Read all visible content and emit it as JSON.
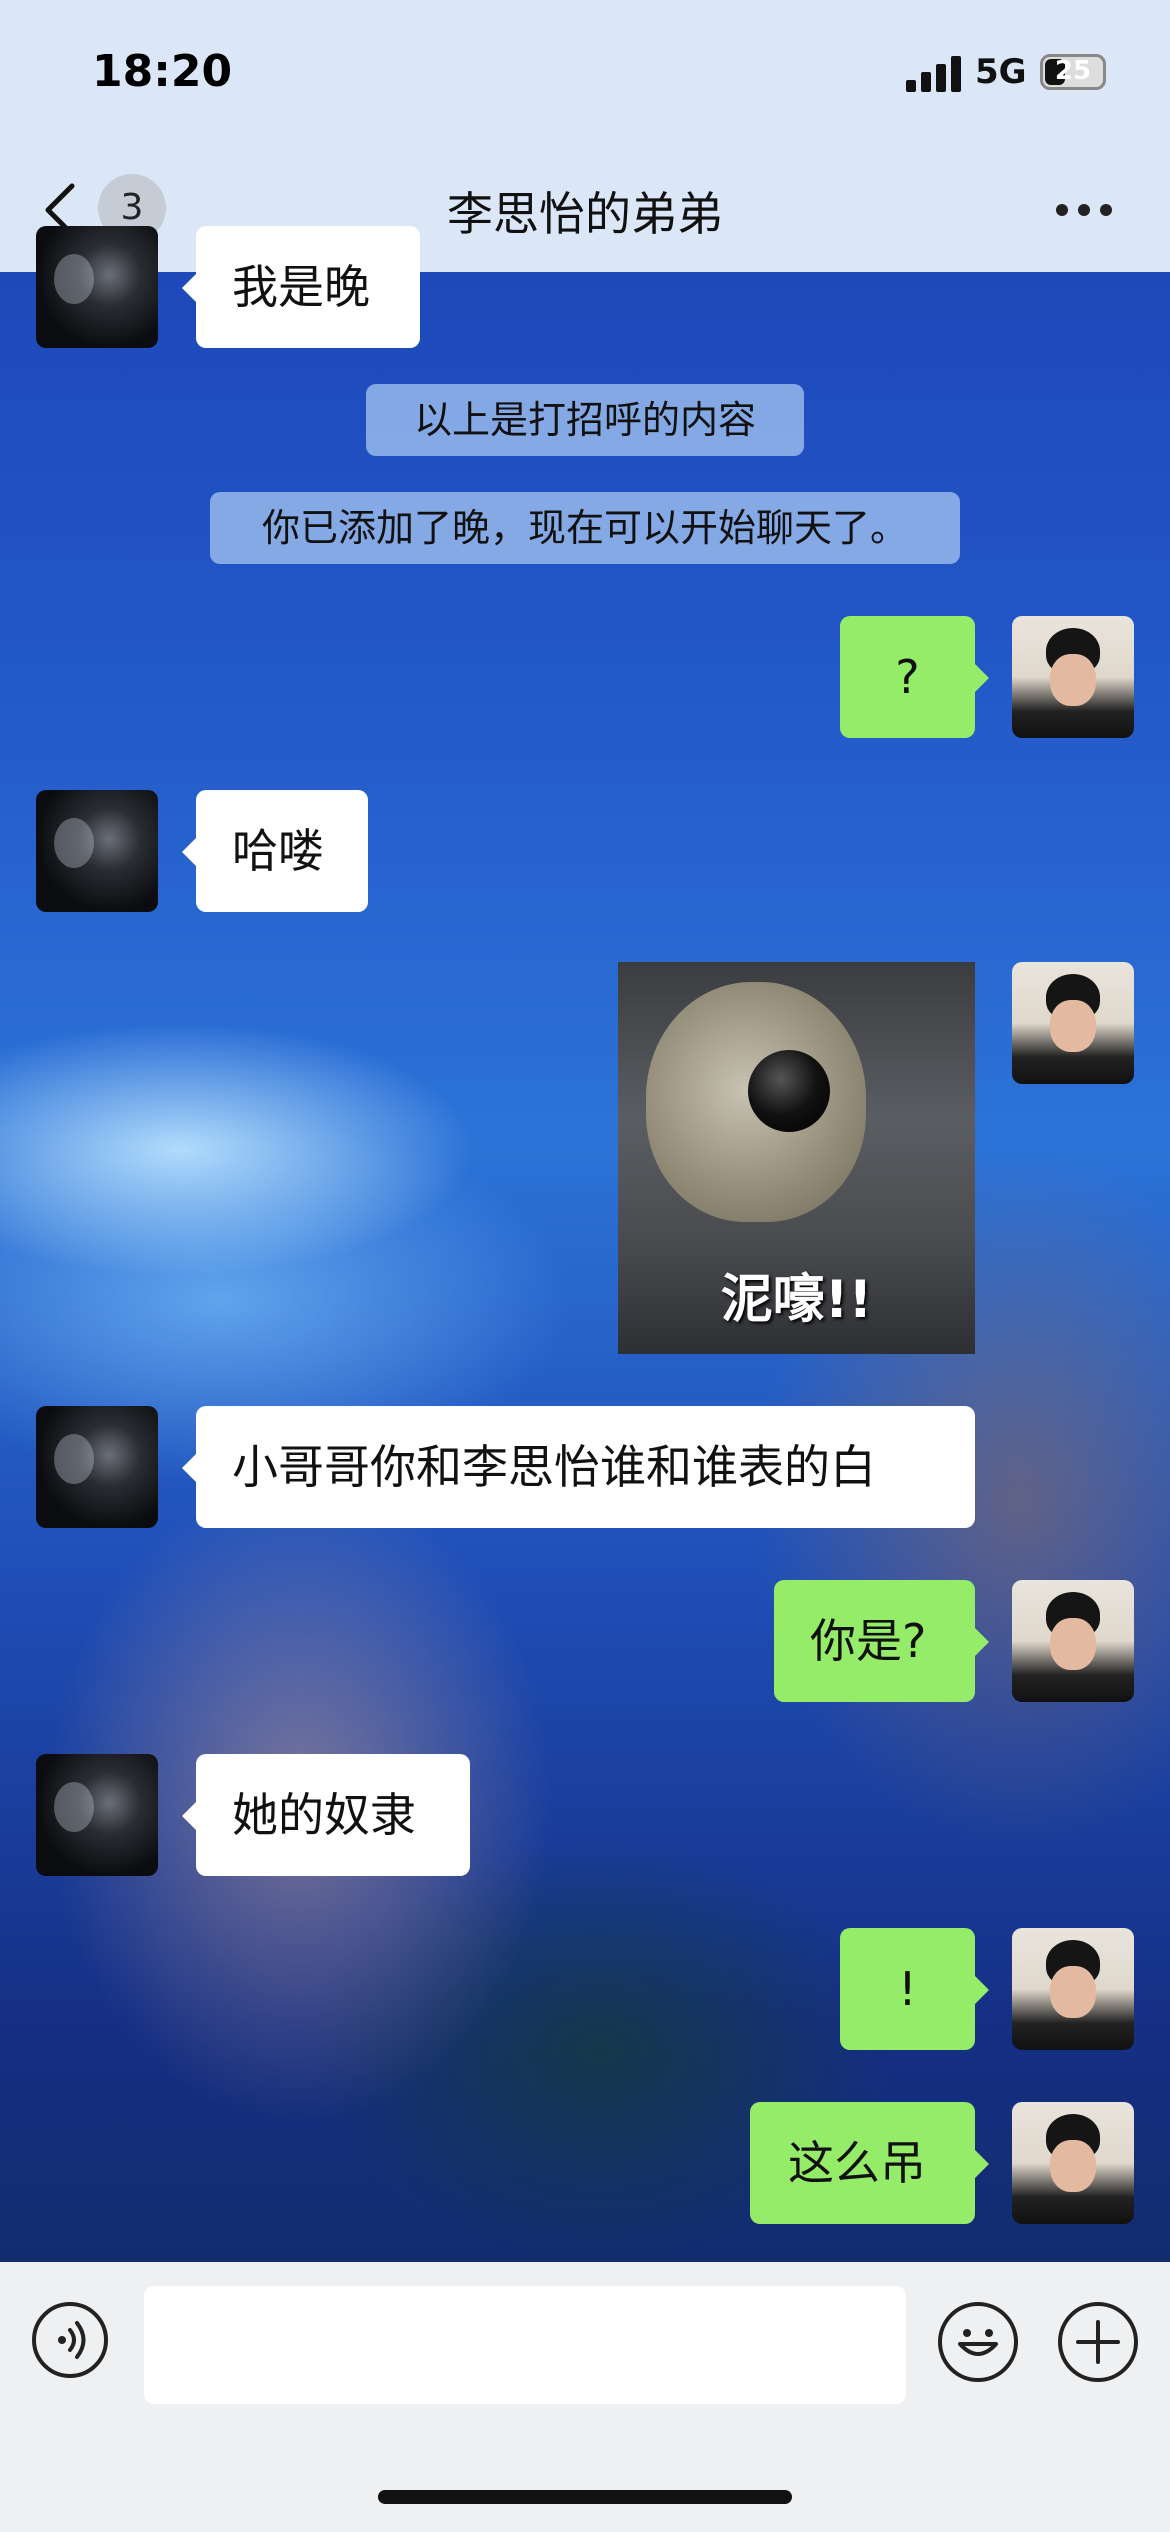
{
  "status_bar": {
    "time": "18:20",
    "network": "5G",
    "battery": "25"
  },
  "header": {
    "unread_count": "3",
    "title": "李思怡的弟弟"
  },
  "messages": [
    {
      "from": "them",
      "type": "text",
      "text": "我是晚"
    },
    {
      "from": "system",
      "type": "system",
      "text": "以上是打招呼的内容"
    },
    {
      "from": "system",
      "type": "system",
      "text": "你已添加了晚，现在可以开始聊天了。"
    },
    {
      "from": "me",
      "type": "text",
      "text": "?"
    },
    {
      "from": "them",
      "type": "text",
      "text": "哈喽"
    },
    {
      "from": "me",
      "type": "sticker",
      "caption": "泥嚎!!"
    },
    {
      "from": "them",
      "type": "text",
      "text": "小哥哥你和李思怡谁和谁表的白"
    },
    {
      "from": "me",
      "type": "text",
      "text": "你是?"
    },
    {
      "from": "them",
      "type": "text",
      "text": "她的奴隶"
    },
    {
      "from": "me",
      "type": "text",
      "text": "!"
    },
    {
      "from": "me",
      "type": "text",
      "text": "这么吊"
    }
  ],
  "input_bar": {
    "value": ""
  },
  "icons": {
    "back": "chevron-left-icon",
    "more": "more-dots-icon",
    "voice": "voice-icon",
    "emoji": "emoji-icon",
    "plus": "plus-icon"
  },
  "colors": {
    "my_bubble": "#95ec69",
    "their_bubble": "#ffffff",
    "header_bg": "#dbe6f7",
    "system_tip": "#96b9eb"
  }
}
